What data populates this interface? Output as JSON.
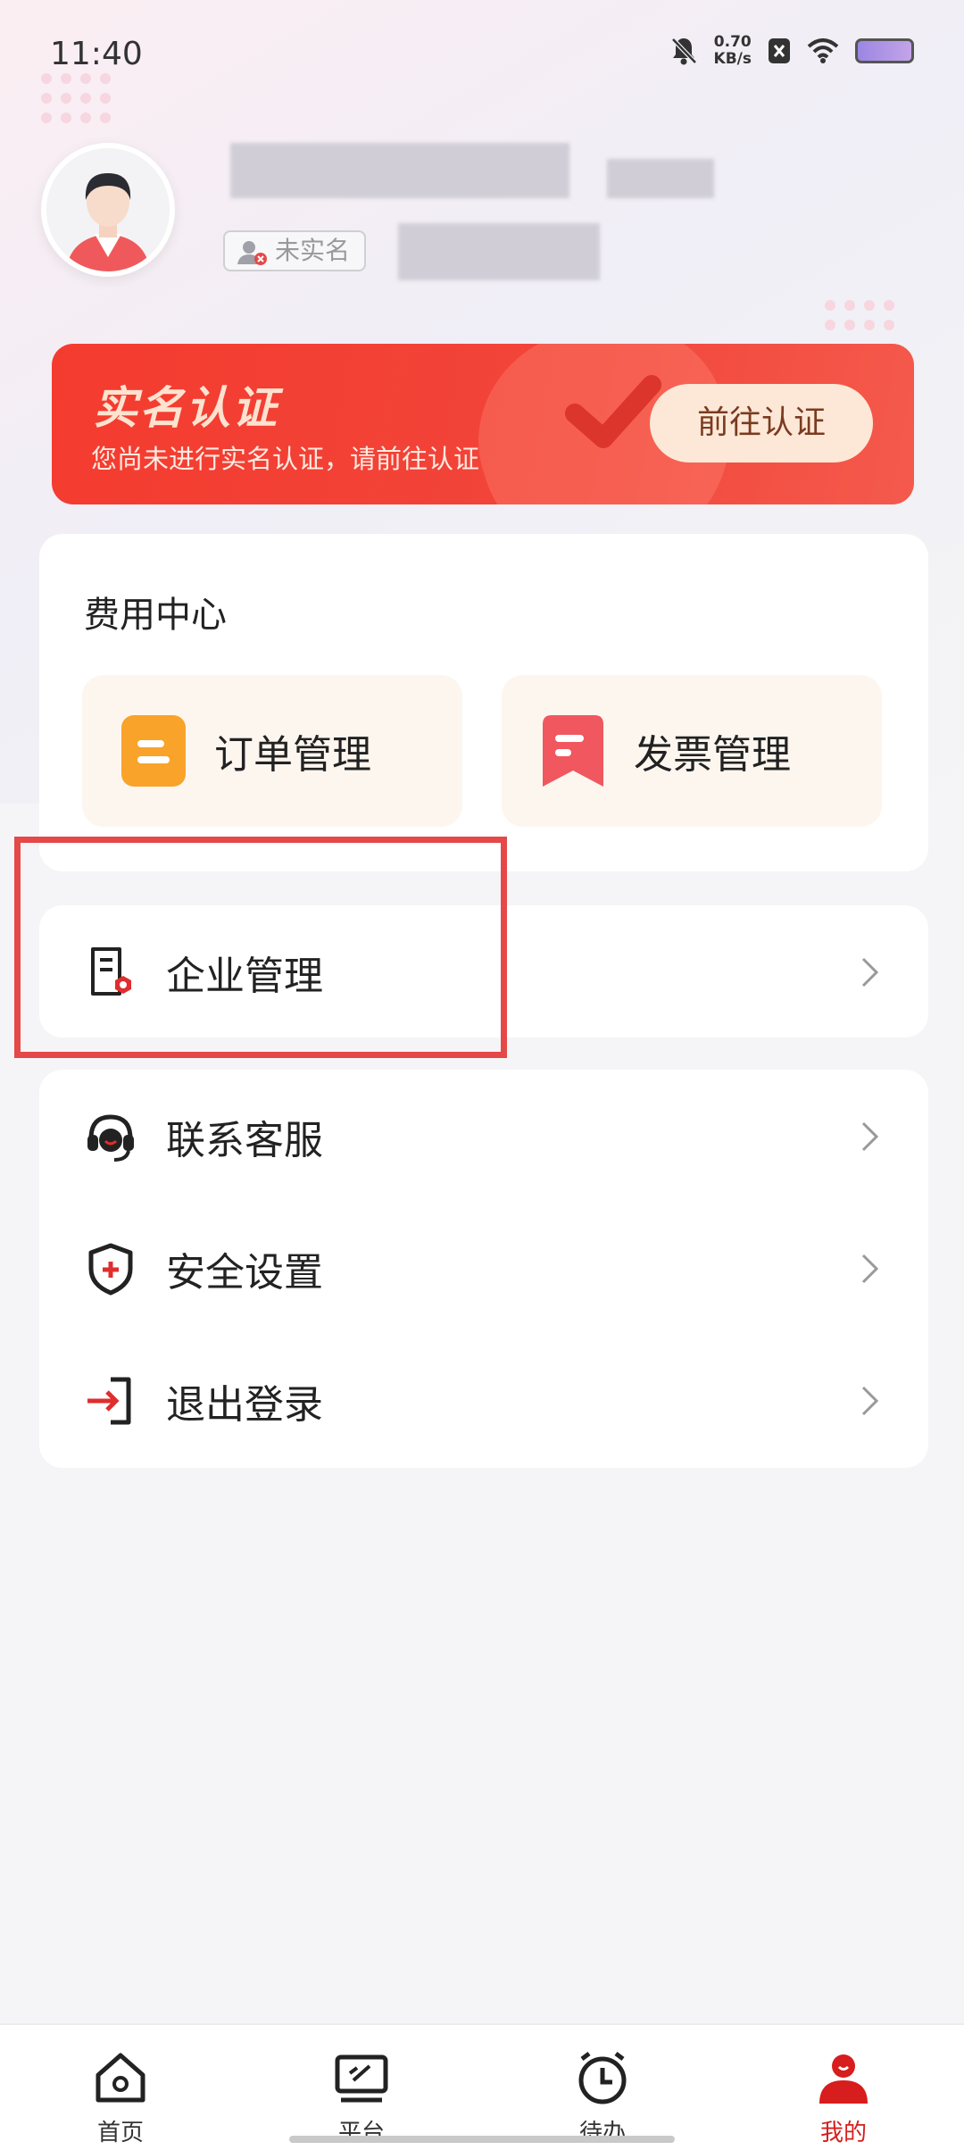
{
  "status_bar": {
    "time": "11:40",
    "net_speed_value": "0.70",
    "net_speed_unit": "KB/s"
  },
  "profile": {
    "verify_status": "未实名"
  },
  "banner": {
    "title": "实名认证",
    "subtitle": "您尚未进行实名认证，请前往认证",
    "button": "前往认证"
  },
  "fee_center": {
    "title": "费用中心",
    "tiles": [
      {
        "label": "订单管理",
        "icon": "order-icon"
      },
      {
        "label": "发票管理",
        "icon": "invoice-icon"
      }
    ]
  },
  "menu": {
    "enterprise": "企业管理",
    "items": [
      {
        "label": "联系客服",
        "icon": "headset-icon"
      },
      {
        "label": "安全设置",
        "icon": "shield-icon"
      },
      {
        "label": "退出登录",
        "icon": "logout-icon"
      }
    ]
  },
  "bottom_nav": {
    "items": [
      {
        "label": "首页",
        "icon": "home-icon"
      },
      {
        "label": "平台",
        "icon": "platform-icon"
      },
      {
        "label": "待办",
        "icon": "clock-icon"
      },
      {
        "label": "我的",
        "icon": "user-icon"
      }
    ],
    "active_index": 3
  },
  "colors": {
    "accent": "#d71d1d",
    "banner": "#f43b2f",
    "highlight": "#e54848"
  }
}
